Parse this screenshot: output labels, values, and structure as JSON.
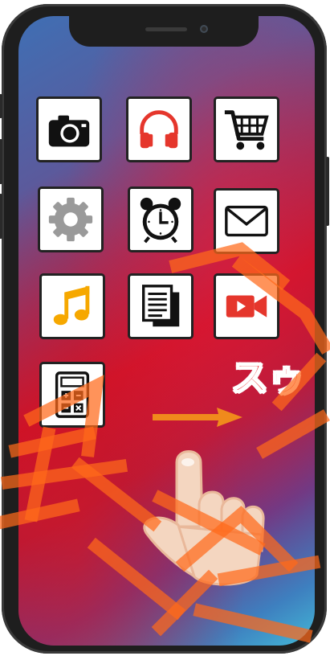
{
  "device": {
    "frame_color": "#1e1e1e",
    "screen_gradient": [
      "#3f6fb4",
      "#c9122a",
      "#43b8d6"
    ]
  },
  "apps": [
    {
      "name": "camera",
      "icon": "camera-icon",
      "color": "#111111"
    },
    {
      "name": "music-headphones",
      "icon": "headphones-icon",
      "color": "#e5362c"
    },
    {
      "name": "shopping",
      "icon": "shopping-cart-icon",
      "color": "#111111"
    },
    {
      "name": "settings",
      "icon": "gear-icon",
      "color": "#9a9a9a"
    },
    {
      "name": "alarm",
      "icon": "alarm-clock-icon",
      "color": "#111111"
    },
    {
      "name": "mail",
      "icon": "envelope-icon",
      "color": "#111111"
    },
    {
      "name": "music",
      "icon": "music-note-icon",
      "color": "#f6a800"
    },
    {
      "name": "documents",
      "icon": "documents-icon",
      "color": "#111111"
    },
    {
      "name": "video",
      "icon": "video-camera-icon",
      "color": "#e5362c"
    },
    {
      "name": "calculator",
      "icon": "calculator-icon",
      "color": "#111111"
    }
  ],
  "gesture": {
    "label": "スゥ",
    "label_color": "#e8141a",
    "arrow_color": "#f08a1c",
    "arrow_icon": "arrow-right-icon",
    "hand_icon": "pointing-hand-icon"
  },
  "watermark": {
    "icon": "watermark-icon",
    "color": "#ff6a1a"
  }
}
